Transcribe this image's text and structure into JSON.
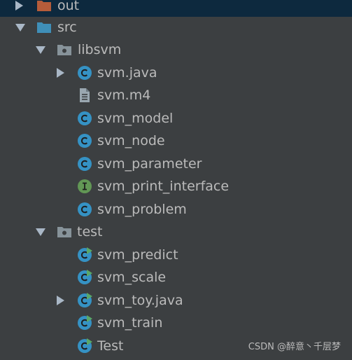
{
  "tree": {
    "out": {
      "label": "out"
    },
    "src": {
      "label": "src"
    },
    "libsvm": {
      "label": "libsvm",
      "items": [
        {
          "label": "svm.java"
        },
        {
          "label": "svm.m4"
        },
        {
          "label": "svm_model"
        },
        {
          "label": "svm_node"
        },
        {
          "label": "svm_parameter"
        },
        {
          "label": "svm_print_interface"
        },
        {
          "label": "svm_problem"
        }
      ]
    },
    "test": {
      "label": "test",
      "items": [
        {
          "label": "svm_predict"
        },
        {
          "label": "svm_scale"
        },
        {
          "label": "svm_toy.java"
        },
        {
          "label": "svm_train"
        },
        {
          "label": "Test"
        }
      ]
    }
  },
  "watermark": "CSDN @醉意丶千层梦",
  "colors": {
    "background": "#3c3f41",
    "selected_row": "#0d293e",
    "text": "#bbbbbb",
    "class_icon": "#3592c4",
    "interface_icon": "#629755",
    "folder": "#87939a",
    "out_folder": "#b55c3a",
    "run_badge": "#59a869"
  }
}
